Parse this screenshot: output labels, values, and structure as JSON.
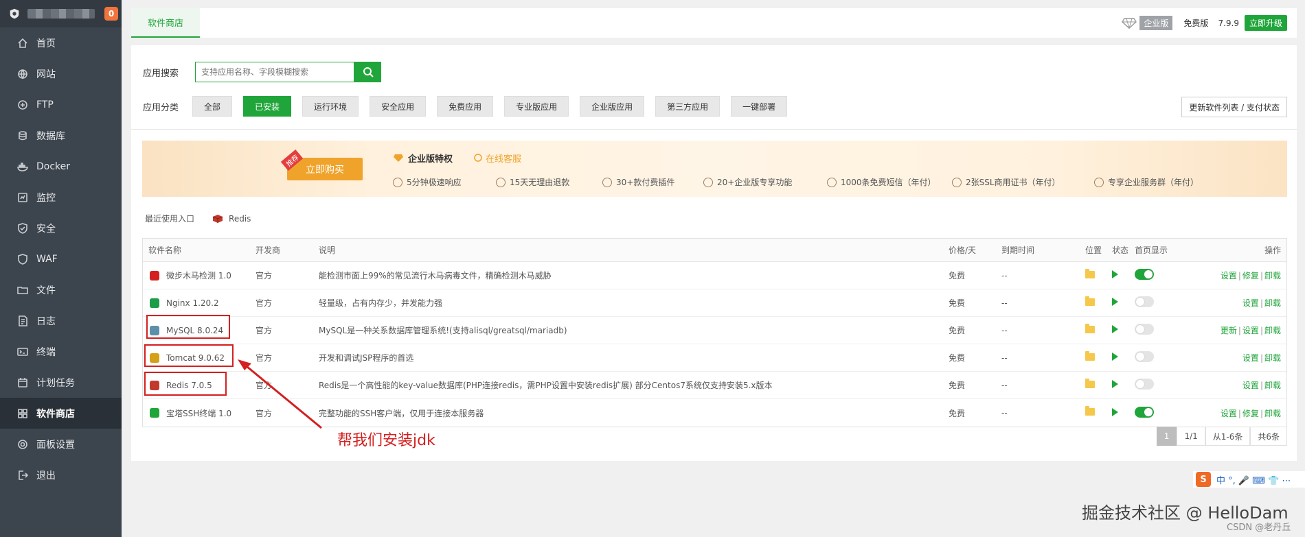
{
  "sidebar": {
    "badge": "0",
    "items": [
      {
        "label": "首页",
        "icon": "home-icon"
      },
      {
        "label": "网站",
        "icon": "globe-icon"
      },
      {
        "label": "FTP",
        "icon": "ftp-icon"
      },
      {
        "label": "数据库",
        "icon": "database-icon"
      },
      {
        "label": "Docker",
        "icon": "docker-icon"
      },
      {
        "label": "监控",
        "icon": "monitor-icon"
      },
      {
        "label": "安全",
        "icon": "shield-icon"
      },
      {
        "label": "WAF",
        "icon": "waf-icon"
      },
      {
        "label": "文件",
        "icon": "folder-icon"
      },
      {
        "label": "日志",
        "icon": "log-icon"
      },
      {
        "label": "终端",
        "icon": "terminal-icon"
      },
      {
        "label": "计划任务",
        "icon": "calendar-icon"
      },
      {
        "label": "软件商店",
        "icon": "grid-icon"
      },
      {
        "label": "面板设置",
        "icon": "gear-icon"
      },
      {
        "label": "退出",
        "icon": "logout-icon"
      }
    ]
  },
  "topbar": {
    "tab": "软件商店",
    "enterprise_label": "企业版",
    "edition": "免费版",
    "version": "7.9.9",
    "upgrade": "立即升级"
  },
  "search": {
    "label": "应用搜索",
    "placeholder": "支持应用名称、字段模糊搜索"
  },
  "categories": {
    "label": "应用分类",
    "items": [
      "全部",
      "已安装",
      "运行环境",
      "安全应用",
      "免费应用",
      "专业版应用",
      "企业版应用",
      "第三方应用",
      "一键部署"
    ],
    "active_index": 1,
    "refresh": "更新软件列表 / 支付状态"
  },
  "banner": {
    "tag": "推荐",
    "buy": "立即购买",
    "title": "企业版特权",
    "service": "在线客服",
    "features": [
      "5分钟极速响应",
      "15天无理由退款",
      "30+款付费插件",
      "20+企业版专享功能",
      "1000条免费短信（年付）",
      "2张SSL商用证书（年付）",
      "专享企业服务群（年付）"
    ]
  },
  "recent": {
    "label": "最近使用入口",
    "item": "Redis"
  },
  "table": {
    "headers": [
      "软件名称",
      "开发商",
      "说明",
      "价格/天",
      "到期时间",
      "位置",
      "状态",
      "首页显示",
      "操作"
    ],
    "rows": [
      {
        "name": "微步木马检测 1.0",
        "dev": "官方",
        "desc": "能检测市面上99%的常见流行木马病毒文件，精确检测木马威胁",
        "price": "免费",
        "expire": "--",
        "home_on": true,
        "ops": [
          "设置",
          "修复",
          "卸载"
        ],
        "icon_color": "#d42020"
      },
      {
        "name": "Nginx 1.20.2",
        "dev": "官方",
        "desc": "轻量级，占有内存少，并发能力强",
        "price": "免费",
        "expire": "--",
        "home_on": false,
        "ops": [
          "设置",
          "卸载"
        ],
        "icon_color": "#1e9c48"
      },
      {
        "name": "MySQL 8.0.24",
        "dev": "官方",
        "desc": "MySQL是一种关系数据库管理系统!(支持alisql/greatsql/mariadb)",
        "price": "免费",
        "expire": "--",
        "home_on": false,
        "ops": [
          "更新",
          "设置",
          "卸载"
        ],
        "icon_color": "#5d8fa8"
      },
      {
        "name": "Tomcat 9.0.62",
        "dev": "官方",
        "desc": "开发和调试JSP程序的首选",
        "price": "免费",
        "expire": "--",
        "home_on": false,
        "ops": [
          "设置",
          "卸载"
        ],
        "icon_color": "#d4a017"
      },
      {
        "name": "Redis 7.0.5",
        "dev": "官方",
        "desc": "Redis是一个高性能的key-value数据库(PHP连接redis，需PHP设置中安装redis扩展) 部分Centos7系统仅支持安装5.x版本",
        "price": "免费",
        "expire": "--",
        "home_on": false,
        "ops": [
          "设置",
          "卸载"
        ],
        "icon_color": "#c0392b"
      },
      {
        "name": "宝塔SSH终端 1.0",
        "dev": "官方",
        "desc": "完整功能的SSH客户端，仅用于连接本服务器",
        "price": "免费",
        "expire": "--",
        "home_on": true,
        "ops": [
          "设置",
          "修复",
          "卸载"
        ],
        "icon_color": "#20a53a"
      }
    ]
  },
  "pager": {
    "current": "1",
    "pages": "1/1",
    "range": "从1-6条",
    "total": "共6条"
  },
  "annotation": "帮我们安装jdk",
  "watermark": "掘金技术社区 @ HelloDam",
  "csdn": "CSDN @老丹丘",
  "ime": {
    "logo": "S",
    "text": "中 °, 🎤 ⌨ 👕 ⋯"
  }
}
